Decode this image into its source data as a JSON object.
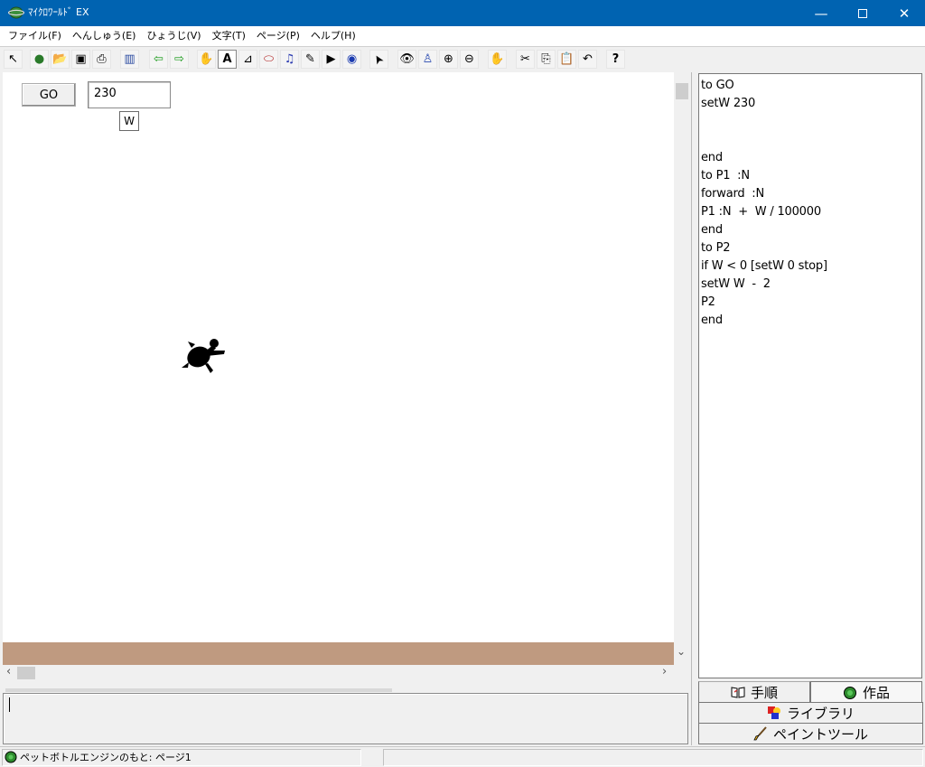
{
  "window": {
    "title": "ﾏｲｸﾛﾜｰﾙﾄﾞ EX",
    "min_glyph": "—",
    "close_glyph": "✕"
  },
  "menu": [
    {
      "label": "ファイル(F)"
    },
    {
      "label": "へんしゅう(E)"
    },
    {
      "label": "ひょうじ(V)"
    },
    {
      "label": "文字(T)"
    },
    {
      "label": "ページ(P)"
    },
    {
      "label": "ヘルプ(H)"
    }
  ],
  "toolbar": {
    "icons": [
      {
        "name": "pointer-small-icon",
        "glyph": "↖"
      },
      {
        "name": "new-world-icon",
        "glyph": "●"
      },
      {
        "name": "open-folder-icon",
        "glyph": "📂"
      },
      {
        "name": "save-disk-icon",
        "glyph": "▣"
      },
      {
        "name": "print-icon",
        "glyph": "⎙"
      },
      {
        "name": "page-view-icon",
        "glyph": "▥"
      },
      {
        "name": "prev-page-icon",
        "glyph": "⇦"
      },
      {
        "name": "next-page-icon",
        "glyph": "⇨"
      },
      {
        "name": "new-turtle-icon",
        "glyph": "✋"
      },
      {
        "name": "text-box-icon",
        "glyph": "A"
      },
      {
        "name": "slider-icon",
        "glyph": "⊿"
      },
      {
        "name": "button-icon",
        "glyph": "⬭"
      },
      {
        "name": "music-icon",
        "glyph": "♫"
      },
      {
        "name": "pen-icon",
        "glyph": "✎"
      },
      {
        "name": "video-icon",
        "glyph": "▶"
      },
      {
        "name": "globe-icon",
        "glyph": "◉"
      },
      {
        "name": "arrow-select-icon",
        "glyph": "➤"
      },
      {
        "name": "eye-icon",
        "glyph": "👁"
      },
      {
        "name": "stamp-icon",
        "glyph": "♙"
      },
      {
        "name": "zoom-in-icon",
        "glyph": "⊕"
      },
      {
        "name": "zoom-out-icon",
        "glyph": "⊖"
      },
      {
        "name": "stop-hand-icon",
        "glyph": "✋"
      },
      {
        "name": "cut-icon",
        "glyph": "✂"
      },
      {
        "name": "copy-icon",
        "glyph": "⎘"
      },
      {
        "name": "paste-icon",
        "glyph": "📋"
      },
      {
        "name": "undo-icon",
        "glyph": "↶"
      },
      {
        "name": "help-icon",
        "glyph": "?"
      }
    ]
  },
  "canvas": {
    "go_button_label": "GO",
    "w_value": "230",
    "w_label": "W",
    "background": "#ffffff",
    "ground_color": "#bf9a80"
  },
  "scroll": {
    "up_arrow": "▲",
    "down_arrow": "⌄",
    "left_arrow": "‹",
    "right_arrow": "›"
  },
  "command_line": {
    "value": ""
  },
  "procedures": {
    "lines": [
      "to GO",
      "setW 230",
      "",
      "",
      "end",
      "to P1  :N",
      "forward  :N",
      "P1 :N  +  W / 100000",
      "end",
      "to P2",
      "if W < 0 [setW 0 stop]",
      "setW W  -  2",
      "P2",
      "end"
    ]
  },
  "tabs": {
    "steps": "手順",
    "works": "作品",
    "library": "ライブラリ",
    "paint": "ペイントツール"
  },
  "status": {
    "text": "ペットボトルエンジンのもと: ページ1"
  }
}
